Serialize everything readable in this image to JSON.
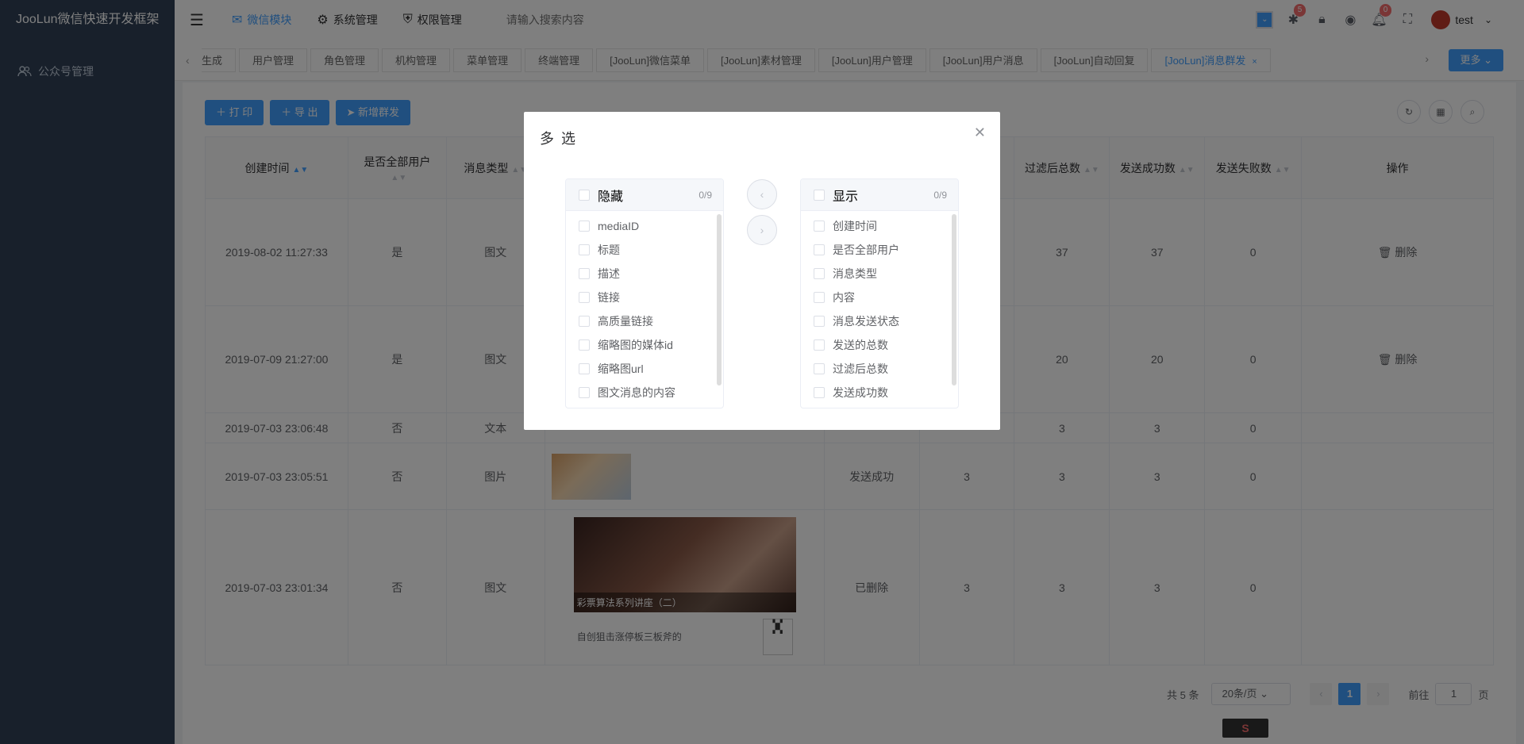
{
  "app": {
    "title": "JooLun微信快速开发框架"
  },
  "sidebar": {
    "items": [
      {
        "label": "公众号管理",
        "icon": "users-icon"
      }
    ]
  },
  "header": {
    "nav": [
      {
        "label": "微信模块",
        "icon": "wechat-icon",
        "active": true
      },
      {
        "label": "系统管理",
        "icon": "gear-icon"
      },
      {
        "label": "权限管理",
        "icon": "shield-icon"
      }
    ],
    "search_placeholder": "请输入搜索内容",
    "bug_badge": "5",
    "bell_badge": "0",
    "username": "test"
  },
  "tags": {
    "items": [
      "生成",
      "用户管理",
      "角色管理",
      "机构管理",
      "菜单管理",
      "终端管理",
      "[JooLun]微信菜单",
      "[JooLun]素材管理",
      "[JooLun]用户管理",
      "[JooLun]用户消息",
      "[JooLun]自动回复",
      "[JooLun]消息群发"
    ],
    "more_label": "更多"
  },
  "toolbar": {
    "print": "打 印",
    "export": "导 出",
    "add": "新增群发"
  },
  "table": {
    "headers": [
      "创建时间",
      "是否全部用户",
      "消息类型",
      "",
      "",
      "",
      "过滤后总数",
      "发送成功数",
      "发送失败数",
      "操作"
    ],
    "rows": [
      {
        "time": "2019-08-02 11:27:33",
        "all": "是",
        "type": "图文",
        "status": "",
        "total": "",
        "filtered": "37",
        "success": "37",
        "fail": "0",
        "op": "删除"
      },
      {
        "time": "2019-07-09 21:27:00",
        "all": "是",
        "type": "图文",
        "status": "",
        "total": "",
        "filtered": "20",
        "success": "20",
        "fail": "0",
        "op": "删除"
      },
      {
        "time": "2019-07-03 23:06:48",
        "all": "否",
        "type": "文本",
        "status": "",
        "total": "",
        "filtered": "3",
        "success": "3",
        "fail": "0",
        "op": ""
      },
      {
        "time": "2019-07-03 23:05:51",
        "all": "否",
        "type": "图片",
        "status": "发送成功",
        "total": "3",
        "filtered": "3",
        "success": "3",
        "fail": "0",
        "op": ""
      },
      {
        "time": "2019-07-03 23:01:34",
        "all": "否",
        "type": "图文",
        "status": "已删除",
        "total": "3",
        "filtered": "3",
        "success": "3",
        "fail": "0",
        "op": ""
      }
    ],
    "news": {
      "title": "彩票算法系列讲座（二）",
      "desc": "自创狙击涨停板三板斧的"
    }
  },
  "pager": {
    "total": "共 5 条",
    "size": "20条/页",
    "page": "1",
    "goto_prefix": "前往",
    "goto_value": "1",
    "goto_suffix": "页"
  },
  "modal": {
    "title": "多 选",
    "left": {
      "title": "隐藏",
      "count": "0/9",
      "items": [
        "mediaID",
        "标题",
        "描述",
        "链接",
        "高质量链接",
        "缩略图的媒体id",
        "缩略图url",
        "图文消息的内容"
      ]
    },
    "right": {
      "title": "显示",
      "count": "0/9",
      "items": [
        "创建时间",
        "是否全部用户",
        "消息类型",
        "内容",
        "消息发送状态",
        "发送的总数",
        "过滤后总数",
        "发送成功数"
      ]
    }
  },
  "colors": {
    "primary": "#409eff",
    "sidebar": "#304156",
    "danger": "#f56c6c"
  }
}
